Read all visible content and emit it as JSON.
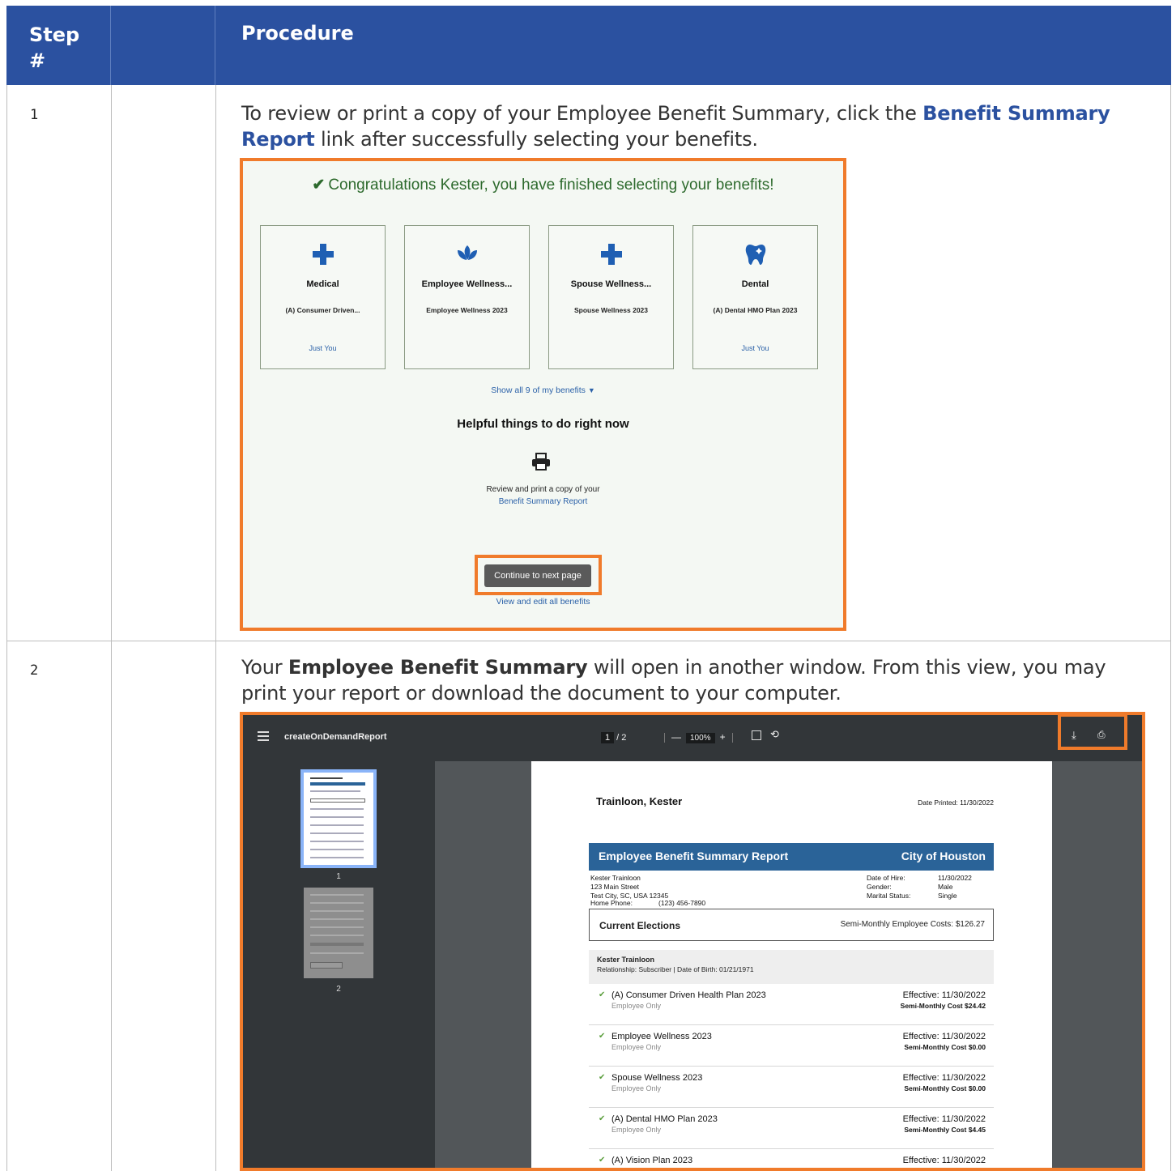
{
  "table": {
    "header": {
      "step": "Step #",
      "procedure": "Procedure"
    },
    "colors": {
      "header_bg": "#2b51a0",
      "highlight": "#f07b2b"
    },
    "rows": [
      {
        "num": "1",
        "before": "To review or print a copy of your Employee Benefit Summary, click the ",
        "link": "Benefit Summary Report",
        "after": " link after successfully selecting your benefits."
      },
      {
        "num": "2",
        "before": "Your ",
        "bold": "Employee Benefit Summary",
        "after": " will open in another window. From this view, you may print your report or download the document to your computer."
      }
    ]
  },
  "enrollment": {
    "congrats": "Congratulations Kester, you have finished selecting your benefits!",
    "cards": [
      {
        "icon": "medical-cross-icon",
        "title": "Medical",
        "plan": "(A) Consumer Driven...",
        "coverage": "Just You"
      },
      {
        "icon": "lotus-icon",
        "title": "Employee Wellness...",
        "plan": "Employee Wellness 2023",
        "coverage": ""
      },
      {
        "icon": "medical-cross-icon",
        "title": "Spouse Wellness...",
        "plan": "Spouse Wellness 2023",
        "coverage": ""
      },
      {
        "icon": "tooth-icon",
        "title": "Dental",
        "plan": "(A) Dental HMO Plan 2023",
        "coverage": "Just You"
      }
    ],
    "show_all": "Show all 9 of my benefits",
    "helpful_title": "Helpful things to do right now",
    "review_text": "Review and print a copy of your",
    "review_link": "Benefit Summary Report",
    "continue_button": "Continue to next page",
    "view_edit": "View and edit all benefits"
  },
  "viewer": {
    "file_name": "createOnDemandReport",
    "page_current": "1",
    "page_total": "/ 2",
    "zoom": "100%",
    "thumb_labels": [
      "1",
      "2"
    ],
    "report": {
      "name": "Trainloon, Kester",
      "date_printed": "Date Printed: 11/30/2022",
      "title": "Employee Benefit Summary Report",
      "employer": "City of Houston",
      "address": [
        "Kester  Trainloon",
        "123 Main Street",
        "Test City, SC, USA 12345"
      ],
      "info_labels": [
        "Date of Hire:",
        "Gender:",
        "Marital Status:"
      ],
      "info_values": [
        "11/30/2022",
        "Male",
        "Single"
      ],
      "home_phone_label": "Home Phone:",
      "home_phone": "(123) 456-7890",
      "current_elections": "Current Elections",
      "semi_monthly_costs": "Semi-Monthly Employee Costs: $126.27",
      "member_name": "Kester  Trainloon",
      "member_detail": "Relationship: Subscriber | Date of Birth: 01/21/1971",
      "plans": [
        {
          "name": "(A) Consumer Driven Health Plan 2023",
          "who": "Employee Only",
          "effective": "Effective: 11/30/2022",
          "cost": "Semi-Monthly Cost $24.42"
        },
        {
          "name": "Employee Wellness 2023",
          "who": "Employee Only",
          "effective": "Effective: 11/30/2022",
          "cost": "Semi-Monthly Cost $0.00"
        },
        {
          "name": "Spouse Wellness 2023",
          "who": "Employee Only",
          "effective": "Effective: 11/30/2022",
          "cost": "Semi-Monthly Cost $0.00"
        },
        {
          "name": "(A) Dental HMO Plan 2023",
          "who": "Employee Only",
          "effective": "Effective: 11/30/2022",
          "cost": "Semi-Monthly Cost $4.45"
        },
        {
          "name": "(A) Vision Plan 2023",
          "who": "",
          "effective": "Effective: 11/30/2022",
          "cost": ""
        }
      ]
    }
  }
}
